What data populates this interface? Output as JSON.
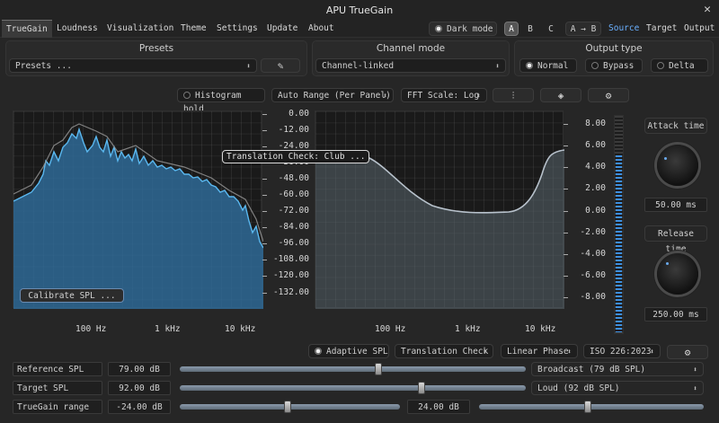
{
  "window": {
    "title": "APU TrueGain",
    "close": "✕"
  },
  "menu": {
    "tabs": [
      "TrueGain",
      "Loudness",
      "Visualization",
      "Theme",
      "Settings",
      "Update",
      "About"
    ],
    "active": "TrueGain",
    "dark_mode": "Dark mode",
    "ab": [
      "A",
      "B",
      "C",
      "A → B"
    ],
    "monitor": [
      "Source",
      "Target",
      "Output"
    ]
  },
  "presets": {
    "label": "Presets",
    "value": "Presets ..."
  },
  "channel_mode": {
    "label": "Channel mode",
    "value": "Channel-linked"
  },
  "output_type": {
    "label": "Output type",
    "options": [
      "Normal",
      "Bypass",
      "Delta"
    ],
    "selected": "Normal"
  },
  "toolbar": {
    "histogram_hold": "Histogram hold",
    "auto_range": "Auto Range (Per Panel)",
    "fft_scale": "FFT Scale: Log"
  },
  "db_scale_left": [
    "0.00",
    "-12.00",
    "-24.00",
    "-36.00",
    "-48.00",
    "-60.00",
    "-72.00",
    "-84.00",
    "-96.00",
    "-108.00",
    "-120.00",
    "-132.00"
  ],
  "db_scale_right": [
    "8.00",
    "6.00",
    "4.00",
    "2.00",
    "0.00",
    "-2.00",
    "-4.00",
    "-6.00",
    "-8.00"
  ],
  "freq_labels": [
    "100 Hz",
    "1 kHz",
    "10 kHz"
  ],
  "calibrate": "Calibrate SPL ...",
  "translation_tooltip": "Translation Check: Club ...",
  "attack": {
    "label": "Attack time",
    "value": "50.00 ms"
  },
  "release": {
    "label": "Release time",
    "value": "250.00 ms"
  },
  "meter_level": 0.82,
  "bottom_bar": {
    "adaptive_spl": "Adaptive SPL",
    "translation_check": "Translation Check",
    "phase": "Linear Phase",
    "iso": "ISO 226:2023"
  },
  "params": {
    "reference_spl": {
      "label": "Reference SPL",
      "value": "79.00 dB",
      "preset": "Broadcast (79 dB SPL)"
    },
    "target_spl": {
      "label": "Target SPL",
      "value": "92.00 dB",
      "preset": "Loud (92 dB SPL)"
    },
    "truegain_range": {
      "label": "TrueGain range",
      "min": "-24.00 dB",
      "max": "24.00 dB"
    }
  },
  "colors": {
    "accent": "#3d8fe0",
    "spectrum_fill": "#2f6a96",
    "link": "#6ab0ff"
  }
}
